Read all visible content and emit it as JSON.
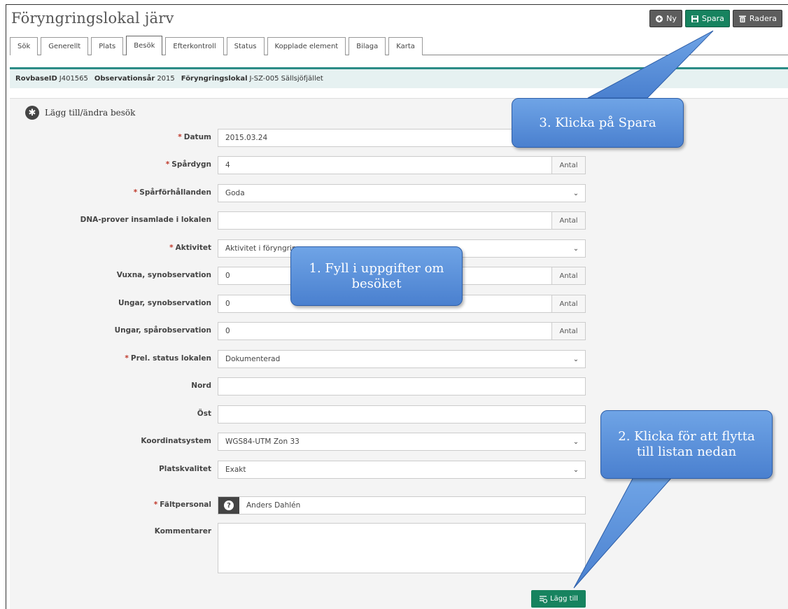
{
  "title": "Föryngringslokal järv",
  "toolbar": {
    "new_label": "Ny",
    "save_label": "Spara",
    "delete_label": "Radera"
  },
  "tabs": [
    "Sök",
    "Generellt",
    "Plats",
    "Besök",
    "Efterkontroll",
    "Status",
    "Kopplade element",
    "Bilaga",
    "Karta"
  ],
  "active_tab": "Besök",
  "info": {
    "rovbase_label": "RovbaseID",
    "rovbase_value": "J401565",
    "obsyear_label": "Observationsår",
    "obsyear_value": "2015",
    "lokal_label": "Föryngringslokal",
    "lokal_value": "J-SZ-005 Sällsjöfjället"
  },
  "panel_title": "Lägg till/ändra besök",
  "form": {
    "datum": {
      "label": "Datum",
      "value": "2015.03.24"
    },
    "spardygn": {
      "label": "Spårdygn",
      "value": "4",
      "addon": "Antal"
    },
    "sparforhallanden": {
      "label": "Spårförhållanden",
      "value": "Goda"
    },
    "dna": {
      "label": "DNA-prover insamlade i lokalen",
      "value": "",
      "addon": "Antal"
    },
    "aktivitet": {
      "label": "Aktivitet",
      "value": "Aktivitet i föryngrin"
    },
    "vuxna": {
      "label": "Vuxna, synobservation",
      "value": "0",
      "addon": "Antal"
    },
    "ungar_syn": {
      "label": "Ungar, synobservation",
      "value": "0",
      "addon": "Antal"
    },
    "ungar_spar": {
      "label": "Ungar, spårobservation",
      "value": "0",
      "addon": "Antal"
    },
    "prel_status": {
      "label": "Prel. status lokalen",
      "value": "Dokumenterad"
    },
    "nord": {
      "label": "Nord",
      "value": ""
    },
    "ost": {
      "label": "Öst",
      "value": ""
    },
    "koordinatsystem": {
      "label": "Koordinatsystem",
      "value": "WGS84-UTM Zon 33"
    },
    "platskvalitet": {
      "label": "Platskvalitet",
      "value": "Exakt"
    },
    "faltpersonal": {
      "label": "Fältpersonal",
      "value": "Anders Dahlén"
    },
    "kommentarer": {
      "label": "Kommentarer",
      "value": ""
    }
  },
  "add_label": "Lägg till",
  "callouts": {
    "c1": "1. Fyll i uppgifter om besöket",
    "c2": "2. Klicka för att flytta till listan nedan",
    "c3": "3. Klicka på Spara"
  }
}
